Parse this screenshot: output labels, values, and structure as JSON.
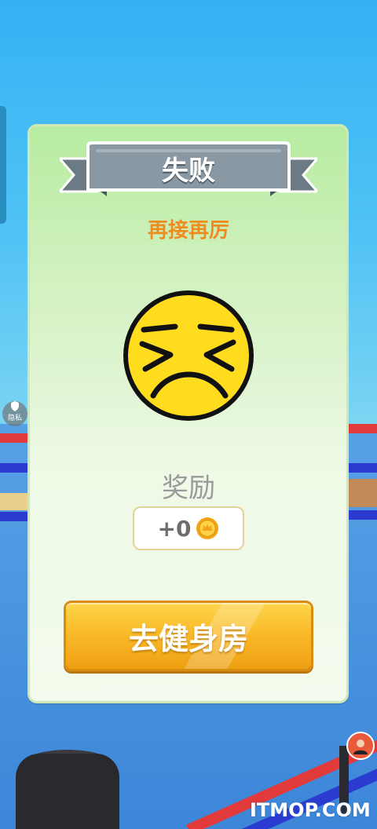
{
  "dialog": {
    "title": "失败",
    "subtitle": "再接再厉",
    "reward_label": "奖励",
    "reward_value": "+0",
    "button_label": "去健身房"
  },
  "overlay": {
    "privacy_label": "隐私"
  },
  "watermark": "ITMOP.COM",
  "icons": {
    "emoji": "frustrated-face-icon",
    "coin": "coin-icon",
    "shield": "shield-icon",
    "avatar": "avatar-icon"
  },
  "colors": {
    "accent": "#f08c1e",
    "button": "#f9b827",
    "panel": "#d9f3c9",
    "ribbon": "#8a98a3"
  }
}
